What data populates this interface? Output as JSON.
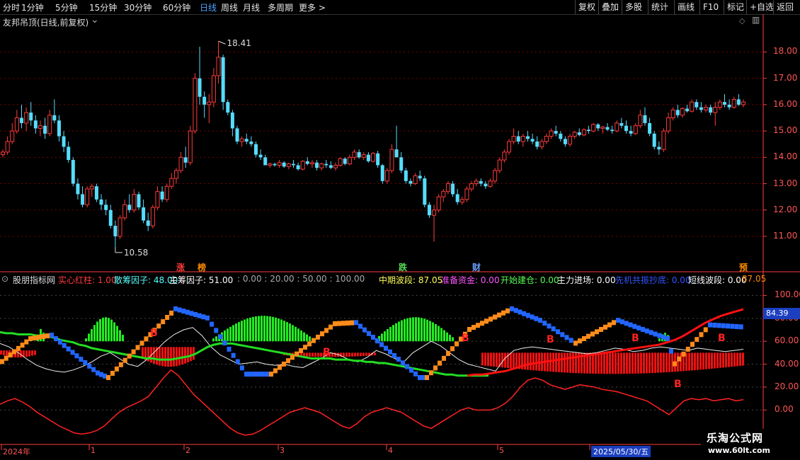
{
  "toolbar": {
    "periods": [
      "分时",
      "1分钟",
      "5分钟",
      "15分钟",
      "30分钟",
      "60分钟",
      "日线",
      "周线",
      "月线",
      "多周期",
      "更多 >"
    ],
    "active_period": "日线",
    "right": [
      "复权",
      "叠加",
      "多股",
      "统计",
      "画线",
      "F10",
      "标记",
      "+自选",
      "返回"
    ]
  },
  "main_chart": {
    "title": "友邦吊顶(日线,前复权)",
    "high_label": "18.41",
    "low_label": "10.58",
    "markers": [
      {
        "text": "涨",
        "color": "#ff3b3b"
      },
      {
        "text": "榜",
        "color": "#ff8c00"
      },
      {
        "text": "跌",
        "color": "#55dd55"
      },
      {
        "text": "财",
        "color": "#6aa0ff"
      },
      {
        "text": "预",
        "color": "#ff8c00"
      }
    ]
  },
  "indicator": {
    "name": "股朋指标网",
    "params": [
      {
        "text": "实心红柱: 1.00",
        "color": "#ff3b3b"
      },
      {
        "text": "散筹因子: 48.00",
        "color": "#55ffff"
      },
      {
        "text": "主筹因子: 51.00",
        "color": "#ffffff"
      },
      {
        "text": ": 0.00 : 20.00 : 50.00 : 100.00",
        "color": "#aaaaaa"
      },
      {
        "text": "中期波段: 87.05",
        "color": "#ffff55"
      },
      {
        "text": "准备资金: 0.00",
        "color": "#ff55ff"
      },
      {
        "text": "开始建仓: 0.00",
        "color": "#55ff55"
      },
      {
        "text": "主力进场: 0.00",
        "color": "#ffffff"
      },
      {
        "text": "先机共振抄底: 0.00",
        "color": "#3355ff"
      },
      {
        "text": "短线波段: 0.00",
        "color": "#ffffff"
      },
      {
        "text": ": 87.05",
        "color": "#ff8c00"
      }
    ],
    "current_value": "84.39",
    "buy_mark": "B"
  },
  "time_axis": {
    "labels": [
      "2024年",
      "1",
      "2",
      "3",
      "4",
      "5",
      "2025/05/30/五"
    ]
  },
  "colors": {
    "up": "#ff3b3b",
    "down": "#55ddff",
    "grid": "#7a0000",
    "axis": "#ff3b3b",
    "ma": "#22dd22"
  },
  "watermark": {
    "title": "乐淘公式网",
    "url": "www.60lt.com"
  },
  "chart_data": {
    "type": "candlestick",
    "price_axis": {
      "ticks": [
        11.0,
        12.0,
        13.0,
        14.0,
        15.0,
        16.0,
        17.0,
        18.0
      ],
      "range": [
        10.3,
        18.9
      ]
    },
    "indicator_axis": {
      "ticks": [
        0.0,
        20.0,
        40.0,
        60.0,
        80.0,
        100.0
      ],
      "range": [
        -22,
        112
      ]
    },
    "candles": [
      [
        14.1,
        14.3,
        14.0,
        14.2
      ],
      [
        14.2,
        14.8,
        14.1,
        14.6
      ],
      [
        14.6,
        15.3,
        14.5,
        15.0
      ],
      [
        15.0,
        15.8,
        14.9,
        15.5
      ],
      [
        15.5,
        16.0,
        15.1,
        15.3
      ],
      [
        15.3,
        15.9,
        15.0,
        15.7
      ],
      [
        15.7,
        16.1,
        15.2,
        15.4
      ],
      [
        15.4,
        15.6,
        14.9,
        15.1
      ],
      [
        15.1,
        15.4,
        14.8,
        15.2
      ],
      [
        15.2,
        15.5,
        14.7,
        14.9
      ],
      [
        14.9,
        15.8,
        14.8,
        15.6
      ],
      [
        15.6,
        16.2,
        15.3,
        15.4
      ],
      [
        15.4,
        15.6,
        14.6,
        14.8
      ],
      [
        14.8,
        15.0,
        14.2,
        14.4
      ],
      [
        14.4,
        14.6,
        13.8,
        13.9
      ],
      [
        13.9,
        14.0,
        12.9,
        13.0
      ],
      [
        13.0,
        13.2,
        12.4,
        12.6
      ],
      [
        12.6,
        12.9,
        12.1,
        12.2
      ],
      [
        12.2,
        12.9,
        12.1,
        12.8
      ],
      [
        12.8,
        13.0,
        12.5,
        12.9
      ],
      [
        12.9,
        13.0,
        12.3,
        12.4
      ],
      [
        12.4,
        12.6,
        12.0,
        12.2
      ],
      [
        12.2,
        12.4,
        11.8,
        12.0
      ],
      [
        12.0,
        12.2,
        11.3,
        11.4
      ],
      [
        11.4,
        11.6,
        10.6,
        11.0
      ],
      [
        11.0,
        11.8,
        10.9,
        11.7
      ],
      [
        11.7,
        12.4,
        11.6,
        12.2
      ],
      [
        12.2,
        12.6,
        11.9,
        12.0
      ],
      [
        12.0,
        12.8,
        11.9,
        12.6
      ],
      [
        12.6,
        12.7,
        12.0,
        12.1
      ],
      [
        12.1,
        12.4,
        11.5,
        11.6
      ],
      [
        11.6,
        11.9,
        11.2,
        11.4
      ],
      [
        11.4,
        12.2,
        11.3,
        12.1
      ],
      [
        12.1,
        12.9,
        12.0,
        12.7
      ],
      [
        12.7,
        12.9,
        12.3,
        12.4
      ],
      [
        12.4,
        13.0,
        12.3,
        12.9
      ],
      [
        12.9,
        13.4,
        12.8,
        13.2
      ],
      [
        13.2,
        13.6,
        13.0,
        13.5
      ],
      [
        13.5,
        14.2,
        13.4,
        14.0
      ],
      [
        14.0,
        14.4,
        13.6,
        13.8
      ],
      [
        13.8,
        15.2,
        13.7,
        15.0
      ],
      [
        15.0,
        17.2,
        14.9,
        17.0
      ],
      [
        17.0,
        18.2,
        16.0,
        16.3
      ],
      [
        16.3,
        16.5,
        15.5,
        16.0
      ],
      [
        16.0,
        16.4,
        15.3,
        16.1
      ],
      [
        16.1,
        17.4,
        15.9,
        17.1
      ],
      [
        17.1,
        18.41,
        16.8,
        17.8
      ],
      [
        17.8,
        17.9,
        15.8,
        16.1
      ],
      [
        16.1,
        16.2,
        15.6,
        15.7
      ],
      [
        15.7,
        15.8,
        14.8,
        15.1
      ],
      [
        15.1,
        15.2,
        14.5,
        14.6
      ],
      [
        14.6,
        14.8,
        14.4,
        14.7
      ],
      [
        14.7,
        14.9,
        14.5,
        14.6
      ],
      [
        14.6,
        14.8,
        14.4,
        14.5
      ],
      [
        14.5,
        14.6,
        14.0,
        14.1
      ],
      [
        14.1,
        14.3,
        13.9,
        14.0
      ],
      [
        14.0,
        14.1,
        13.7,
        13.7
      ],
      [
        13.7,
        13.8,
        13.6,
        13.75
      ],
      [
        13.75,
        13.8,
        13.65,
        13.7
      ],
      [
        13.7,
        13.9,
        13.6,
        13.8
      ],
      [
        13.8,
        13.85,
        13.6,
        13.65
      ],
      [
        13.65,
        13.8,
        13.55,
        13.75
      ],
      [
        13.75,
        13.9,
        13.6,
        13.7
      ],
      [
        13.7,
        13.8,
        13.5,
        13.55
      ],
      [
        13.55,
        13.9,
        13.5,
        13.85
      ],
      [
        13.85,
        14.0,
        13.7,
        13.75
      ],
      [
        13.75,
        13.9,
        13.6,
        13.8
      ],
      [
        13.8,
        13.9,
        13.5,
        13.6
      ],
      [
        13.6,
        13.8,
        13.5,
        13.75
      ],
      [
        13.75,
        13.9,
        13.6,
        13.7
      ],
      [
        13.7,
        13.85,
        13.55,
        13.6
      ],
      [
        13.6,
        13.8,
        13.5,
        13.7
      ],
      [
        13.7,
        14.0,
        13.65,
        13.95
      ],
      [
        13.95,
        14.0,
        13.7,
        13.75
      ],
      [
        13.75,
        14.1,
        13.7,
        14.0
      ],
      [
        14.0,
        14.3,
        13.9,
        14.2
      ],
      [
        14.2,
        14.3,
        13.95,
        14.0
      ],
      [
        14.0,
        14.2,
        13.9,
        14.1
      ],
      [
        14.1,
        14.2,
        13.8,
        13.85
      ],
      [
        13.85,
        14.2,
        13.8,
        14.15
      ],
      [
        14.15,
        14.25,
        13.6,
        13.7
      ],
      [
        13.7,
        13.75,
        13.0,
        13.1
      ],
      [
        13.1,
        13.6,
        13.0,
        13.5
      ],
      [
        13.5,
        14.5,
        13.4,
        14.3
      ],
      [
        14.3,
        15.2,
        14.2,
        14.0
      ],
      [
        14.0,
        14.2,
        13.4,
        13.5
      ],
      [
        13.5,
        13.6,
        13.0,
        13.1
      ],
      [
        13.1,
        13.2,
        12.9,
        13.0
      ],
      [
        13.0,
        13.4,
        12.95,
        13.3
      ],
      [
        13.3,
        13.5,
        13.1,
        13.2
      ],
      [
        13.2,
        13.3,
        12.1,
        12.2
      ],
      [
        12.2,
        12.3,
        11.7,
        11.8
      ],
      [
        11.8,
        12.2,
        10.8,
        12.0
      ],
      [
        12.0,
        12.6,
        11.9,
        12.5
      ],
      [
        12.5,
        12.8,
        12.3,
        12.7
      ],
      [
        12.7,
        13.1,
        12.6,
        13.0
      ],
      [
        13.0,
        13.1,
        12.5,
        12.6
      ],
      [
        12.6,
        12.8,
        12.2,
        12.3
      ],
      [
        12.3,
        12.5,
        12.2,
        12.4
      ],
      [
        12.4,
        12.9,
        12.3,
        12.8
      ],
      [
        12.8,
        13.1,
        12.7,
        13.0
      ],
      [
        13.0,
        13.2,
        12.9,
        13.1
      ],
      [
        13.1,
        13.2,
        12.9,
        13.0
      ],
      [
        13.0,
        13.1,
        12.8,
        12.9
      ],
      [
        12.9,
        13.2,
        12.85,
        13.1
      ],
      [
        13.1,
        13.6,
        13.0,
        13.5
      ],
      [
        13.5,
        14.0,
        13.4,
        13.9
      ],
      [
        13.9,
        14.3,
        13.8,
        14.2
      ],
      [
        14.2,
        14.7,
        14.1,
        14.6
      ],
      [
        14.6,
        15.1,
        14.5,
        14.8
      ],
      [
        14.8,
        15.0,
        14.5,
        14.6
      ],
      [
        14.6,
        14.9,
        14.4,
        14.8
      ],
      [
        14.8,
        15.0,
        14.6,
        14.7
      ],
      [
        14.7,
        14.9,
        14.5,
        14.6
      ],
      [
        14.6,
        14.8,
        14.3,
        14.4
      ],
      [
        14.4,
        14.7,
        14.3,
        14.6
      ],
      [
        14.6,
        14.9,
        14.5,
        14.8
      ],
      [
        14.8,
        15.1,
        14.7,
        15.0
      ],
      [
        15.0,
        15.2,
        14.8,
        14.9
      ],
      [
        14.9,
        15.0,
        14.6,
        14.7
      ],
      [
        14.7,
        14.8,
        14.4,
        14.5
      ],
      [
        14.5,
        14.9,
        14.4,
        14.8
      ],
      [
        14.8,
        15.0,
        14.7,
        14.95
      ],
      [
        14.95,
        15.1,
        14.8,
        14.85
      ],
      [
        14.85,
        15.1,
        14.8,
        15.05
      ],
      [
        15.05,
        15.2,
        14.9,
        15.0
      ],
      [
        15.0,
        15.3,
        14.95,
        15.25
      ],
      [
        15.25,
        15.3,
        15.0,
        15.1
      ],
      [
        15.1,
        15.2,
        14.9,
        15.15
      ],
      [
        15.15,
        15.3,
        15.0,
        15.05
      ],
      [
        15.05,
        15.2,
        14.9,
        15.0
      ],
      [
        15.0,
        15.4,
        14.95,
        15.3
      ],
      [
        15.3,
        15.5,
        15.1,
        15.2
      ],
      [
        15.2,
        15.4,
        14.9,
        15.0
      ],
      [
        15.0,
        15.2,
        14.8,
        14.9
      ],
      [
        14.9,
        15.3,
        14.85,
        15.2
      ],
      [
        15.2,
        15.8,
        15.1,
        15.6
      ],
      [
        15.6,
        15.9,
        15.2,
        15.3
      ],
      [
        15.3,
        15.5,
        14.8,
        14.9
      ],
      [
        14.9,
        15.0,
        14.3,
        14.4
      ],
      [
        14.4,
        14.6,
        14.1,
        14.3
      ],
      [
        14.3,
        15.1,
        14.2,
        15.0
      ],
      [
        15.0,
        15.7,
        14.9,
        15.5
      ],
      [
        15.5,
        15.9,
        15.4,
        15.8
      ],
      [
        15.8,
        16.0,
        15.5,
        15.6
      ],
      [
        15.6,
        15.9,
        15.5,
        15.85
      ],
      [
        15.85,
        16.0,
        15.7,
        15.75
      ],
      [
        15.75,
        16.2,
        15.7,
        16.1
      ],
      [
        16.1,
        16.2,
        15.8,
        15.9
      ],
      [
        15.9,
        16.1,
        15.7,
        15.8
      ],
      [
        15.8,
        16.0,
        15.7,
        15.9
      ],
      [
        15.9,
        16.0,
        15.6,
        15.7
      ],
      [
        15.7,
        16.1,
        15.2,
        15.9
      ],
      [
        15.9,
        16.2,
        15.8,
        16.1
      ],
      [
        16.1,
        16.4,
        15.9,
        16.0
      ],
      [
        16.0,
        16.2,
        15.8,
        15.9
      ],
      [
        15.9,
        16.3,
        15.85,
        16.2
      ],
      [
        16.2,
        16.4,
        15.95,
        16.0
      ],
      [
        16.0,
        16.2,
        15.9,
        16.1
      ]
    ],
    "ma_line": [
      68,
      67,
      67,
      66,
      66,
      66,
      65,
      65,
      64,
      63,
      61,
      60,
      59,
      57,
      56,
      54,
      53,
      52,
      51,
      50,
      49,
      48,
      47,
      46,
      45,
      45,
      44,
      44,
      44,
      45,
      46,
      47,
      49,
      52,
      55,
      57,
      58,
      58,
      58,
      57,
      56,
      55,
      54,
      53,
      52,
      51,
      50,
      49,
      48,
      47,
      46,
      45,
      45,
      45,
      45,
      44,
      44,
      44,
      43,
      43,
      42,
      42,
      41,
      41,
      40,
      39,
      38,
      37,
      36,
      35,
      34,
      33,
      32,
      31,
      31,
      30,
      30,
      30,
      30,
      30,
      30
    ],
    "red_trend": [
      30,
      31,
      31,
      32,
      33,
      34,
      36,
      38,
      40,
      41,
      42,
      43,
      44,
      45,
      46,
      47,
      48,
      49,
      50,
      51,
      52,
      53,
      54,
      55,
      56,
      57,
      59,
      61,
      64,
      68,
      72,
      76,
      79,
      82,
      84,
      86,
      88
    ],
    "white_line": [
      58,
      55,
      50,
      44,
      39,
      36,
      34,
      33,
      35,
      38,
      42,
      47,
      50,
      45,
      40,
      38,
      44,
      52,
      60,
      66,
      70,
      72,
      65,
      55,
      48,
      44,
      40,
      41,
      42,
      40,
      39,
      40,
      38,
      37,
      41,
      45,
      50,
      48,
      44,
      42,
      46,
      52,
      49,
      45,
      42,
      50,
      55,
      60,
      56,
      50,
      44,
      40,
      38,
      36,
      34,
      45,
      52,
      54,
      55,
      54,
      53,
      52,
      51,
      50,
      49,
      50,
      52,
      54,
      53,
      51,
      52,
      54,
      55,
      54,
      53,
      52,
      54,
      53,
      52,
      51,
      52,
      53
    ],
    "bottom_line": [
      5,
      8,
      10,
      7,
      3,
      -2,
      -6,
      -10,
      -14,
      -17,
      -20,
      -21,
      -20,
      -18,
      -14,
      -8,
      -2,
      2,
      5,
      8,
      12,
      20,
      28,
      35,
      30,
      22,
      14,
      8,
      2,
      -4,
      -10,
      -16,
      -20,
      -22,
      -21,
      -18,
      -14,
      -10,
      -6,
      -2,
      0,
      2,
      0,
      -2,
      -6,
      -10,
      -14,
      -16,
      -12,
      -6,
      -2,
      0,
      2,
      0,
      -2,
      -6,
      -10,
      -14,
      -16,
      -12,
      -8,
      -4,
      0,
      2,
      0,
      0,
      0,
      2,
      6,
      12,
      20,
      26,
      28,
      26,
      22,
      20,
      18,
      20,
      22,
      21,
      20,
      18,
      17,
      16,
      14,
      12,
      10,
      8,
      4,
      0,
      -4,
      2,
      8,
      10,
      9,
      10,
      8,
      9,
      10,
      8,
      9
    ]
  }
}
